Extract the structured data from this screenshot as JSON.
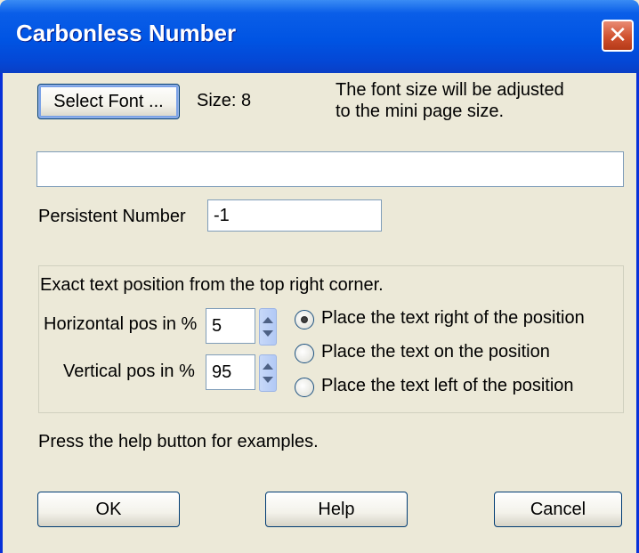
{
  "window": {
    "title": "Carbonless Number"
  },
  "font": {
    "select_button": "Select Font ...",
    "size_label": "Size: 8",
    "note_line1": "The font size will be adjusted",
    "note_line2": "to the mini page size."
  },
  "text_field": {
    "value": ""
  },
  "persistent": {
    "label": "Persistent Number",
    "value": "-1"
  },
  "position": {
    "group_label": "Exact text position from the top right corner.",
    "horizontal_label": "Horizontal pos in %",
    "horizontal_value": "5",
    "vertical_label": "Vertical pos in %",
    "vertical_value": "95",
    "options": [
      {
        "label": "Place the text right of the position",
        "selected": true
      },
      {
        "label": "Place the text on the position",
        "selected": false
      },
      {
        "label": "Place the text left of the position",
        "selected": false
      }
    ]
  },
  "help_hint": "Press the help button for examples.",
  "buttons": {
    "ok": "OK",
    "help": "Help",
    "cancel": "Cancel"
  },
  "colors": {
    "titlebar": "#0054e3",
    "dialog_bg": "#ece9d8",
    "close": "#d0512f"
  }
}
